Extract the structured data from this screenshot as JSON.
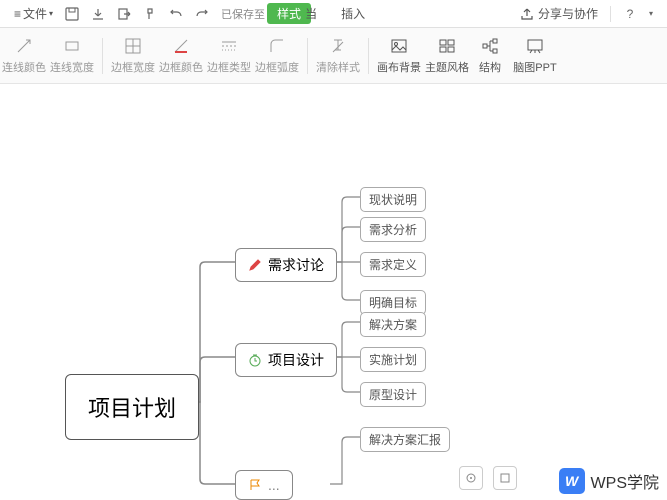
{
  "topbar": {
    "file_label": "文件",
    "save_status": "已保存至",
    "tab_style": "样式",
    "tab_partial": "当",
    "tab_insert": "插入",
    "share_label": "分享与协作"
  },
  "ribbon": {
    "line_color": "连线颜色",
    "line_width": "连线宽度",
    "border_width": "边框宽度",
    "border_color": "边框颜色",
    "border_style": "边框类型",
    "border_radius": "边框弧度",
    "clear_style": "清除样式",
    "canvas_bg": "画布背景",
    "theme_style": "主题风格",
    "structure": "结构",
    "mindmap_ppt": "脑图PPT"
  },
  "mindmap": {
    "root": "项目计划",
    "b1": {
      "label": "需求讨论",
      "children": [
        "现状说明",
        "需求分析",
        "需求定义",
        "明确目标"
      ]
    },
    "b2": {
      "label": "项目设计",
      "children": [
        "解决方案",
        "实施计划",
        "原型设计"
      ]
    },
    "b3": {
      "label_partial": "解决方案汇报"
    }
  },
  "watermark": {
    "logo": "W",
    "text": "WPS学院"
  }
}
